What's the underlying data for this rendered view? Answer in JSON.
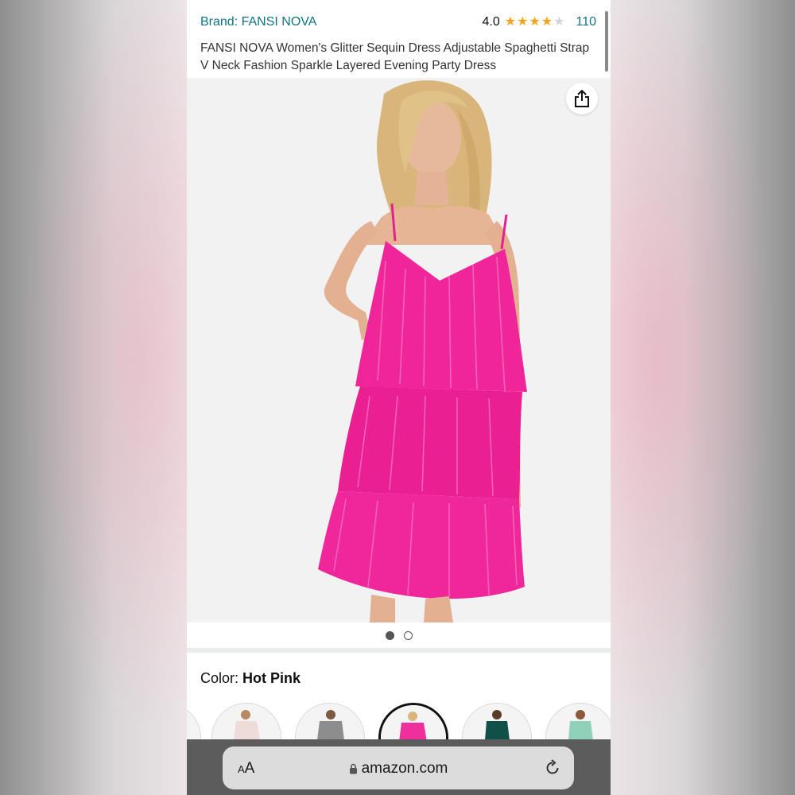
{
  "header": {
    "brand": "Brand: FANSI NOVA",
    "rating": "4.0",
    "stars_filled": 4,
    "stars_total": 5,
    "review_count": "110",
    "title": "FANSI NOVA Women's Glitter Sequin Dress Adjustable Spaghetti Strap V Neck Fashion Sparkle Layered Evening Party Dress"
  },
  "gallery": {
    "share_icon": "share-icon",
    "pages": 2,
    "current_page": 1
  },
  "color": {
    "label": "Color:",
    "selected": "Hot Pink"
  },
  "swatches": [
    {
      "name": "swatch-1",
      "color": "#e9e4e2"
    },
    {
      "name": "swatch-2",
      "color": "#eddcd7"
    },
    {
      "name": "swatch-3",
      "color": "#8d8d8d"
    },
    {
      "name": "swatch-4",
      "color": "#ef2f9b"
    },
    {
      "name": "swatch-5",
      "color": "#0f5148"
    },
    {
      "name": "swatch-6",
      "color": "#8fd1b9"
    }
  ],
  "browser": {
    "aa_label_small": "A",
    "aa_label_large": "A",
    "url": "amazon.com"
  },
  "colors": {
    "link": "#117382",
    "star": "#f7a41d",
    "dress": "#f0259a"
  }
}
